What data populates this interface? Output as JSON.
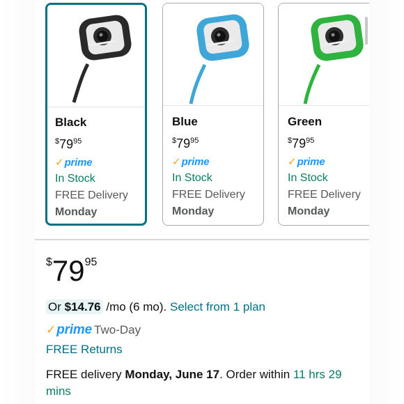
{
  "variants": [
    {
      "name": "Black",
      "price_whole": "79",
      "price_fraction": "95",
      "currency": "$",
      "prime": "prime",
      "stock": "In Stock",
      "delivery": "FREE Delivery",
      "day": "Monday",
      "color": "#2a2a2a"
    },
    {
      "name": "Blue",
      "price_whole": "79",
      "price_fraction": "95",
      "currency": "$",
      "prime": "prime",
      "stock": "In Stock",
      "delivery": "FREE Delivery",
      "day": "Monday",
      "color": "#3fa6d8"
    },
    {
      "name": "Green",
      "price_whole": "79",
      "price_fraction": "95",
      "currency": "$",
      "prime": "prime",
      "stock": "In Stock",
      "delivery": "FREE Delivery",
      "day": "Monday",
      "color": "#2fb33f"
    }
  ],
  "selected_variant": "Black",
  "main_price": {
    "currency": "$",
    "whole": "79",
    "fraction": "95"
  },
  "monthly": {
    "prefix": "Or",
    "amount": "$14.76",
    "suffix": "/mo (6 mo).",
    "link": "Select from 1 plan"
  },
  "prime_shipping": {
    "badge": "prime",
    "text": "Two-Day"
  },
  "returns": {
    "text": "FREE Returns"
  },
  "delivery_info": {
    "prefix": "FREE delivery",
    "date": "Monday, June 17",
    "middle": ". Order within",
    "countdown": "11 hrs 29 mins"
  },
  "colors": {
    "accent_teal": "#007185",
    "stock_green": "#067d62",
    "prime_blue": "#1a98ff",
    "prime_check": "#f7a521"
  }
}
